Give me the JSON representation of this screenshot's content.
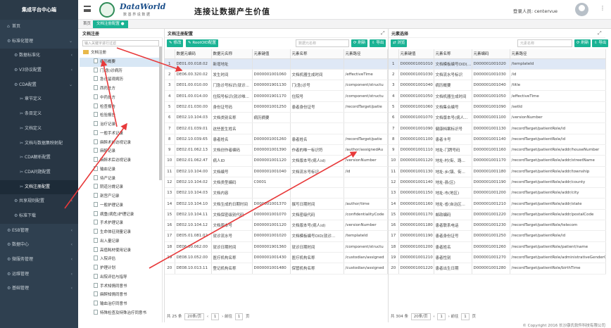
{
  "sidebar": {
    "title": "集成平台中心端",
    "items": [
      {
        "label": "首页",
        "icon": "home-icon",
        "glyph": "⌂",
        "level": 0
      },
      {
        "label": "标准化管理",
        "icon": "gear-icon",
        "glyph": "⚙",
        "level": 0,
        "caret": "⌄"
      },
      {
        "label": "数据标准化",
        "icon": "gear-icon",
        "glyph": "⚙",
        "level": 1,
        "caret": "‹"
      },
      {
        "label": "V3协议配置",
        "icon": "gear-icon",
        "glyph": "⚙",
        "level": 1,
        "caret": "‹"
      },
      {
        "label": "CDA配置",
        "icon": "gear-icon",
        "glyph": "⚙",
        "level": 1,
        "caret": "⌄"
      },
      {
        "label": "章节定义",
        "icon": "tools-icon",
        "glyph": "✂",
        "level": 2
      },
      {
        "label": "条目定义",
        "icon": "tools-icon",
        "glyph": "✂",
        "level": 2
      },
      {
        "label": "文档定义",
        "icon": "tools-icon",
        "glyph": "✂",
        "level": 2
      },
      {
        "label": "文档与数据集映射配",
        "icon": "tools-icon",
        "glyph": "✂",
        "level": 2
      },
      {
        "label": "CDA解析配置",
        "icon": "tools-icon",
        "glyph": "✂",
        "level": 2
      },
      {
        "label": "CDA问题配置",
        "icon": "tools-icon",
        "glyph": "✂",
        "level": 2
      },
      {
        "label": "文档注册配置",
        "icon": "tools-icon",
        "glyph": "✂",
        "level": 2,
        "active": true
      },
      {
        "label": "共享规则配置",
        "icon": "gear-icon",
        "glyph": "⚙",
        "level": 1,
        "caret": "‹"
      },
      {
        "label": "标准下载",
        "icon": "gear-icon",
        "glyph": "⚙",
        "level": 1
      },
      {
        "label": "ESB管理",
        "icon": "gear-icon",
        "glyph": "⚙",
        "level": 0,
        "caret": "‹"
      },
      {
        "label": "数据中心",
        "icon": "gear-icon",
        "glyph": "⚙",
        "level": 0,
        "caret": "‹"
      },
      {
        "label": "微服务管理",
        "icon": "gear-icon",
        "glyph": "⚙",
        "level": 0,
        "caret": "‹"
      },
      {
        "label": "运维管理",
        "icon": "gear-icon",
        "glyph": "⚙",
        "level": 0,
        "caret": "‹"
      },
      {
        "label": "基础管理",
        "icon": "gear-icon",
        "glyph": "⚙",
        "level": 0,
        "caret": "‹"
      }
    ]
  },
  "header": {
    "logo_title": "DataWorld",
    "logo_subtitle": "数 基 界 说 数 据",
    "slogan": "连接让数据产生价值",
    "user_label": "登录人员:",
    "user_name": "centervue",
    "more_glyph": "⋮"
  },
  "tabs": {
    "home": "首页",
    "current": "文档注册配置 ●"
  },
  "tree": {
    "heading": "文档注册",
    "search_placeholder": "输入关键字进行过滤",
    "root": "文档注册",
    "children": [
      "病历概要",
      "门(急)诊病历",
      "急诊留观病历",
      "西药处方",
      "中药处方",
      "检查报告",
      "检验报告",
      "治疗记录",
      "一般手术记录",
      "麻醉术前访视记录",
      "麻醉记录",
      "麻醉术后访视记录",
      "输血记录",
      "待产记录",
      "阴道分娩记录",
      "剖宫产记录",
      "一般护理记录",
      "病重(病危)护理记录",
      "手术护理记录",
      "生命体征测量记录",
      "出入量记录",
      "高值耗材使用记录",
      "入院评估",
      "护理计划",
      "出院评估与指导",
      "手术知情同意书",
      "麻醉知情同意书",
      "输血治疗同意书",
      "特殊检查及特殊治疗同意书"
    ],
    "selected_index": 0
  },
  "middle": {
    "heading": "文档注册配置",
    "buttons": {
      "edit": "✎ 修改",
      "root_oid": "✎ RootOID配置",
      "refresh": "⟳ 刷新",
      "export": "⇩ 导出"
    },
    "search_placeholder": "数据元名称",
    "columns": [
      "",
      "数据元编码",
      "数据元名称",
      "元素键值",
      "元素名称",
      "元素路径"
    ],
    "rows": [
      [
        "1",
        "DE01.00.018.02",
        "新增地址",
        "",
        "",
        ""
      ],
      [
        "2",
        "DE06.00.320.02",
        "发生时间",
        "D000001001060",
        "文档机器生成时间",
        "/effectiveTime"
      ],
      [
        "3",
        "DE01.00.010.00",
        "门急诊号标识(就诊...",
        "D000001901130",
        "门(急)诊号",
        "/component/structu"
      ],
      [
        "4",
        "DE01.00.014.00",
        "住院号标识(就诊唯...",
        "D000001901170",
        "住院号",
        "/component/structu"
      ],
      [
        "5",
        "DE02.01.030.00",
        "身份证号码",
        "D000001001250",
        "患者身份证号",
        "/recordTarget/patie"
      ],
      [
        "6",
        "DE02.10.104.03",
        "文档类别名称",
        "病历摘要",
        "",
        ""
      ],
      [
        "7",
        "DE02.01.039.01",
        "这些医生姓名",
        "",
        "",
        ""
      ],
      [
        "8",
        "DE02.10.039.65",
        "患者姓名",
        "D000001001260",
        "患者姓名",
        "/recordTarget/patie"
      ],
      [
        "9",
        "DE02.01.062.13",
        "文档创作者编码",
        "D000001001390",
        "作者的唯一标识符",
        "/author/assignedAu"
      ],
      [
        "10",
        "DE02.01.062.47",
        "病人ID",
        "D000001001120",
        "文档版本号(病人id)",
        "/versionNumber"
      ],
      [
        "11",
        "DE02.10.104.00",
        "文档编号",
        "D000001001040",
        "文档流水号标识",
        "/id"
      ],
      [
        "12",
        "DE02.10.104.02",
        "文档类型编码",
        "C0001",
        "",
        ""
      ],
      [
        "13",
        "DE02.10.104.03",
        "文档内容",
        "",
        "",
        ""
      ],
      [
        "14",
        "DE02.10.104.10",
        "文档生成的日期时间",
        "D000001001370",
        "撰写日期时间",
        "/author/time"
      ],
      [
        "15",
        "DE02.10.104.11",
        "文档保密级别代码",
        "D000001001070",
        "文档密级代码",
        "/confidentialityCode"
      ],
      [
        "16",
        "DE02.10.104.12",
        "文档版本号",
        "D000001001120",
        "文档版本号(病人id)",
        "/versionNumber"
      ],
      [
        "17",
        "DE05.01.081.02",
        "就诊流水号",
        "D000001001020",
        "文档模板编号OID(就诊...",
        "/templateId"
      ],
      [
        "18",
        "DE06.00.062.00",
        "就诊日期时间",
        "D000001901360",
        "就诊日期时间",
        "/component/structu"
      ],
      [
        "19",
        "DE08.10.052.00",
        "医疗机构名称",
        "D000001001430",
        "医疗机构名称",
        "/custodian/assigned"
      ],
      [
        "20",
        "DE08.10.013.11",
        "登记机构名称",
        "D000001001480",
        "保管机构名称",
        "/custodian/assigned"
      ]
    ],
    "pager": {
      "total": "共 25 条",
      "page_size": "20条/页",
      "prev": "‹",
      "page": "1",
      "next": "›",
      "goto_label": "前往",
      "goto_value": "1",
      "goto_unit": "页"
    }
  },
  "right": {
    "heading": "元素选择",
    "buttons": {
      "browse": "⇄ 浏览",
      "refresh": "⟳ 刷新",
      "export": "⇩ 导出"
    },
    "search_placeholder": "元素名称",
    "columns": [
      "",
      "元素键值",
      "元素名称",
      "元素编码",
      "元素路径"
    ],
    "rows": [
      [
        "1",
        "D000001001010",
        "文档模板编号OID(...",
        "D000001001020",
        "/templateId"
      ],
      [
        "2",
        "D000001001030",
        "文档流水号标识",
        "D000001001030",
        "/id"
      ],
      [
        "3",
        "D000001001040",
        "病历概要",
        "D000001001040",
        "/title"
      ],
      [
        "4",
        "D000001001050",
        "文档机器生成时间",
        "D000001001050",
        "/effectiveTime"
      ],
      [
        "5",
        "D000001001060",
        "文档集合编号",
        "D000001001090",
        "/setId"
      ],
      [
        "6",
        "D000001001070",
        "文档版本号(病人...",
        "D000001001100",
        "/versionNumber"
      ],
      [
        "7",
        "D000001001090",
        "健康档案标识号",
        "D000001001130",
        "/recordTarget/patientRole/id"
      ],
      [
        "8",
        "D000001001100",
        "患者卡号",
        "D000001001140",
        "/recordTarget/patientRole/id"
      ],
      [
        "9",
        "D000001001110",
        "地址-门牌号码",
        "D000001001160",
        "/recordTarget/patientRole/addr/houseNumber"
      ],
      [
        "10",
        "D000001001120",
        "地址-村(街、路...",
        "D000001001170",
        "/recordTarget/patientRole/addr/streetName"
      ],
      [
        "11",
        "D000001001130",
        "地址-乡(镇、街...",
        "D000001001180",
        "/recordTarget/patientRole/addr/township"
      ],
      [
        "12",
        "D000001001140",
        "地址-县(区)",
        "D000001001190",
        "/recordTarget/patientRole/addr/county"
      ],
      [
        "13",
        "D000001001150",
        "地址-市(地区)",
        "D000001001200",
        "/recordTarget/patientRole/addr/city"
      ],
      [
        "14",
        "D000001001160",
        "地址-省(自治区...",
        "D000001001210",
        "/recordTarget/patientRole/addr/state"
      ],
      [
        "15",
        "D000001001170",
        "邮政编码",
        "D000001001220",
        "/recordTarget/patientRole/addr/postalCode"
      ],
      [
        "16",
        "D000001001180",
        "患者联系电话",
        "D000001001230",
        "/recordTarget/patientRole/telecom"
      ],
      [
        "17",
        "D000001001190",
        "患者身份证号",
        "D000001001250",
        "/recordTarget/patientRole/id"
      ],
      [
        "18",
        "D000001001200",
        "患者姓名",
        "D000001001260",
        "/recordTarget/patientRole/patient/name"
      ],
      [
        "19",
        "D000001001210",
        "患者性别",
        "D000001001270",
        "/recordTarget/patientRole/administrativeGenderCode"
      ],
      [
        "20",
        "D000001001220",
        "患者出生日期",
        "D000001001280",
        "/recordTarget/patientRole/birthTime"
      ]
    ],
    "pager": {
      "total": "共 304 条",
      "page_size": "20条/页",
      "prev": "‹",
      "page": "1",
      "next": "›",
      "goto_label": "前往",
      "goto_value": "1",
      "goto_unit": "页"
    }
  },
  "footer": "© Copyright 2016 长沙康氏软件科技有限公司",
  "colors": {
    "sidebar": "#2f4050",
    "accent": "#1ab394",
    "selected_row": "#dfe8f6",
    "arrow": "#e8393a"
  }
}
